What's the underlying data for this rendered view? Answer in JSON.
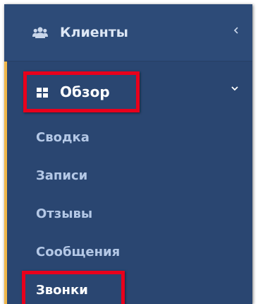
{
  "sidebar": {
    "clients": {
      "label": "Клиенты",
      "icon": "users-icon",
      "toggle_icon": "chevron-left-icon"
    },
    "overview": {
      "label": "Обзор",
      "icon": "grid-icon",
      "toggle_icon": "chevron-down-icon",
      "expanded": true,
      "items": [
        {
          "label": "Сводка"
        },
        {
          "label": "Записи"
        },
        {
          "label": "Отзывы"
        },
        {
          "label": "Сообщения"
        },
        {
          "label": "Звонки",
          "active": true
        }
      ]
    }
  },
  "colors": {
    "panel": "#2f4e7b",
    "accent": "#f0b74a",
    "highlight": "#e8001c",
    "submenu_text": "#b4c8e6"
  }
}
